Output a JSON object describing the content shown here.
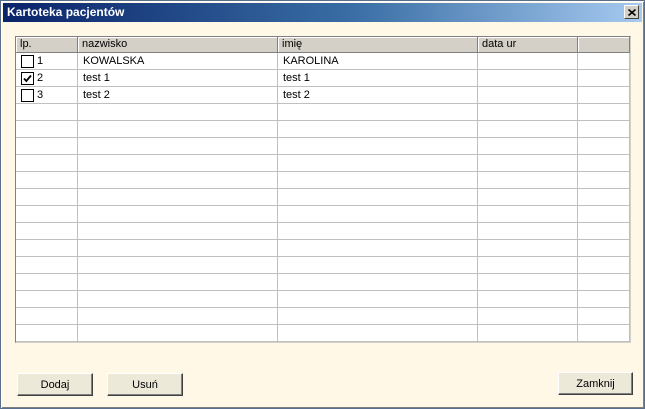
{
  "window": {
    "title": "Kartoteka pacjentów"
  },
  "table": {
    "columns": [
      "lp.",
      "nazwisko",
      "imię",
      "data ur",
      ""
    ],
    "rows": [
      {
        "checked": false,
        "lp": "1",
        "nazwisko": "KOWALSKA",
        "imie": "KAROLINA",
        "data_ur": ""
      },
      {
        "checked": true,
        "lp": "2",
        "nazwisko": "test 1",
        "imie": "test 1",
        "data_ur": ""
      },
      {
        "checked": false,
        "lp": "3",
        "nazwisko": "test 2",
        "imie": "test 2",
        "data_ur": ""
      }
    ],
    "empty_rows": 14
  },
  "buttons": {
    "add": "Dodaj",
    "remove": "Usuń",
    "close": "Zamknij"
  },
  "icons": {
    "close": "close-icon",
    "checkbox_checked": "checkmark-icon"
  }
}
